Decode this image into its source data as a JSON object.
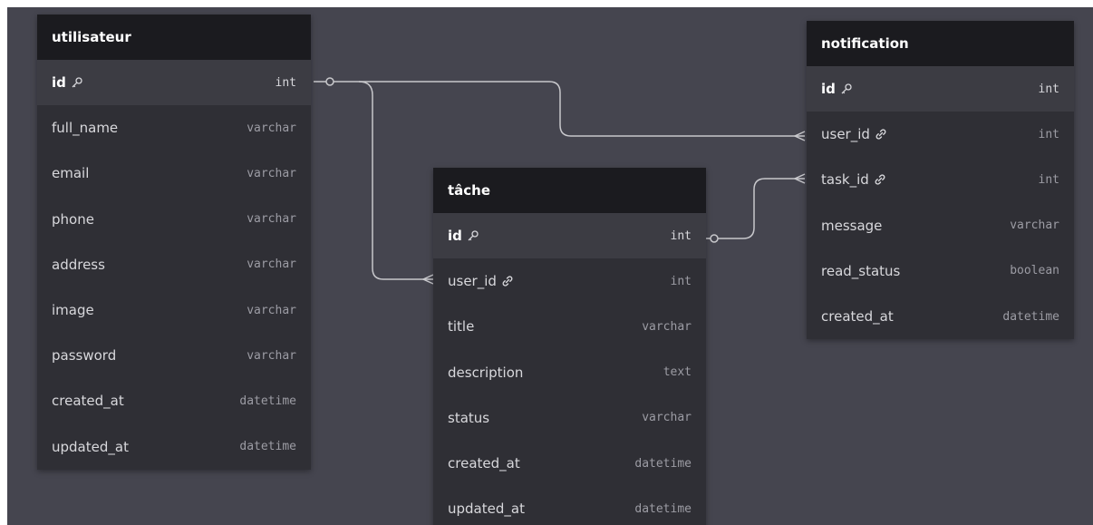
{
  "tables": {
    "utilisateur": {
      "name": "utilisateur",
      "fields": [
        {
          "name": "id",
          "type": "int"
        },
        {
          "name": "full_name",
          "type": "varchar"
        },
        {
          "name": "email",
          "type": "varchar"
        },
        {
          "name": "phone",
          "type": "varchar"
        },
        {
          "name": "address",
          "type": "varchar"
        },
        {
          "name": "image",
          "type": "varchar"
        },
        {
          "name": "password",
          "type": "varchar"
        },
        {
          "name": "created_at",
          "type": "datetime"
        },
        {
          "name": "updated_at",
          "type": "datetime"
        }
      ]
    },
    "tache": {
      "name": "tâche",
      "fields": [
        {
          "name": "id",
          "type": "int"
        },
        {
          "name": "user_id",
          "type": "int"
        },
        {
          "name": "title",
          "type": "varchar"
        },
        {
          "name": "description",
          "type": "text"
        },
        {
          "name": "status",
          "type": "varchar"
        },
        {
          "name": "created_at",
          "type": "datetime"
        },
        {
          "name": "updated_at",
          "type": "datetime"
        }
      ]
    },
    "notification": {
      "name": "notification",
      "fields": [
        {
          "name": "id",
          "type": "int"
        },
        {
          "name": "user_id",
          "type": "int"
        },
        {
          "name": "task_id",
          "type": "int"
        },
        {
          "name": "message",
          "type": "varchar"
        },
        {
          "name": "read_status",
          "type": "boolean"
        },
        {
          "name": "created_at",
          "type": "datetime"
        }
      ]
    }
  },
  "icons": {
    "primary_key": "key-icon",
    "foreign_key": "link-icon"
  },
  "colors": {
    "canvas": "#45454f",
    "table_body": "#2f2f35",
    "table_header": "#1b1b1f",
    "connector": "#c8c8cc"
  },
  "relations": [
    {
      "from": "utilisateur.id",
      "to": "notification.user_id"
    },
    {
      "from": "utilisateur.id",
      "to": "tâche.user_id"
    },
    {
      "from": "tâche.id",
      "to": "notification.task_id"
    }
  ]
}
